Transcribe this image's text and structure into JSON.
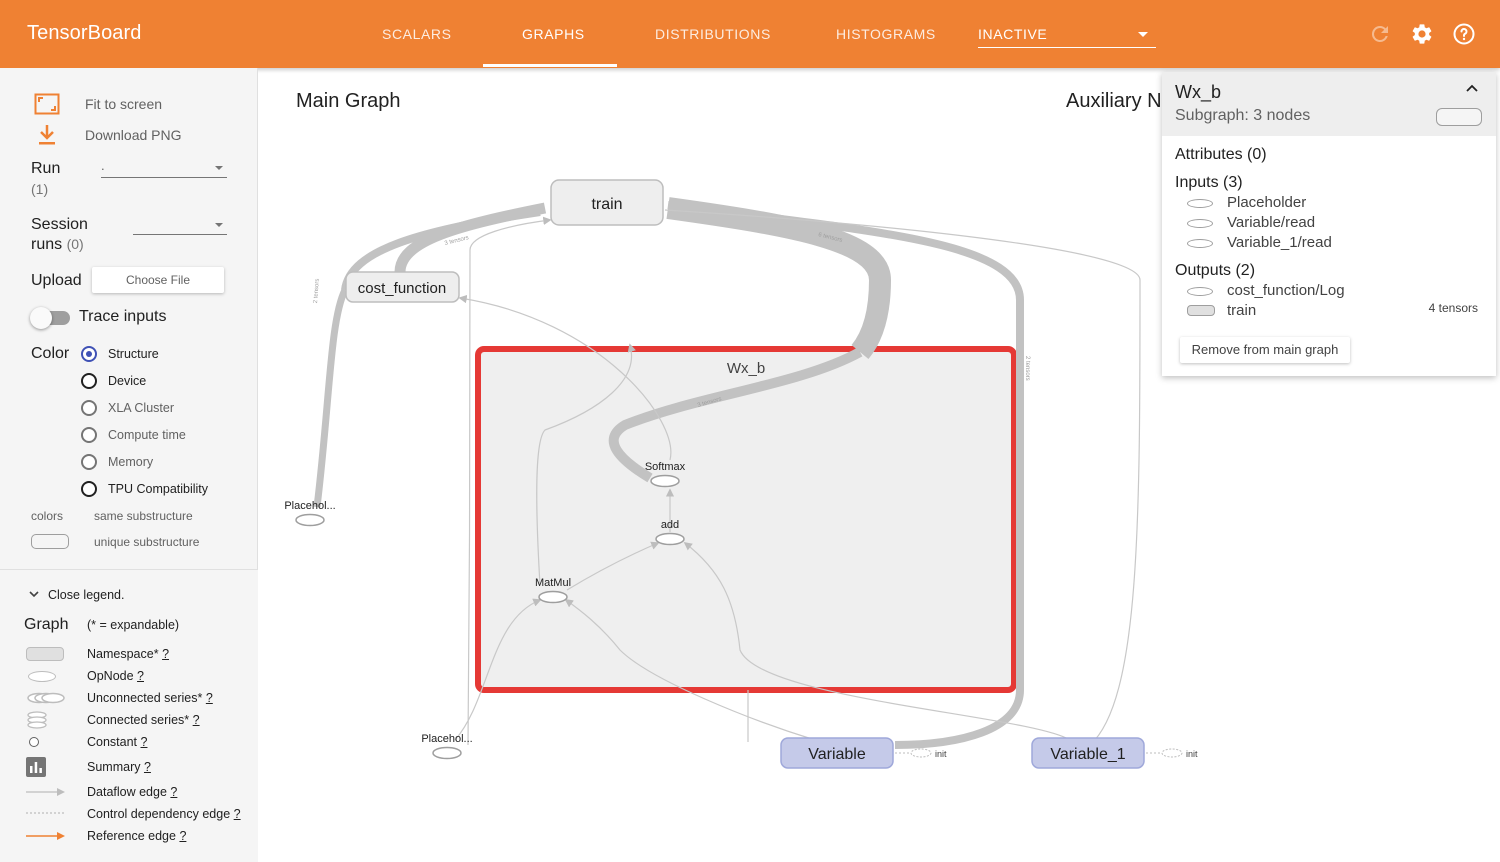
{
  "app": {
    "title": "TensorBoard"
  },
  "tabs": [
    {
      "label": "SCALARS"
    },
    {
      "label": "GRAPHS"
    },
    {
      "label": "DISTRIBUTIONS"
    },
    {
      "label": "HISTOGRAMS"
    }
  ],
  "inactive_select": {
    "label": "INACTIVE"
  },
  "top_icons": [
    "refresh-icon",
    "settings-icon",
    "help-icon"
  ],
  "sidebar": {
    "fit_to_screen": "Fit to screen",
    "download_png": "Download PNG",
    "run_label": "Run",
    "run_count": "(1)",
    "run_value": ".",
    "session_label": "Session",
    "session_label2": "runs",
    "session_count": "(0)",
    "upload_label": "Upload",
    "choose_file": "Choose File",
    "trace_inputs": "Trace inputs",
    "color_label": "Color",
    "color_options": [
      {
        "label": "Structure",
        "selected": true
      },
      {
        "label": "Device",
        "selected": false
      },
      {
        "label": "XLA Cluster",
        "selected": false
      },
      {
        "label": "Compute time",
        "selected": false
      },
      {
        "label": "Memory",
        "selected": false
      },
      {
        "label": "TPU Compatibility",
        "selected": false
      }
    ],
    "colors_label": "colors",
    "same_substructure": "same substructure",
    "unique_substructure": "unique substructure"
  },
  "legend": {
    "close_label": "Close legend.",
    "graph_label": "Graph",
    "expandable_note": "(* = expandable)",
    "items": [
      {
        "label": "Namespace*",
        "q": "?"
      },
      {
        "label": "OpNode",
        "q": "?"
      },
      {
        "label": "Unconnected series*",
        "q": "?"
      },
      {
        "label": "Connected series*",
        "q": "?"
      },
      {
        "label": "Constant",
        "q": "?"
      },
      {
        "label": "Summary",
        "q": "?"
      },
      {
        "label": "Dataflow edge",
        "q": "?"
      },
      {
        "label": "Control dependency edge",
        "q": "?"
      },
      {
        "label": "Reference edge",
        "q": "?"
      }
    ]
  },
  "graph": {
    "main_title": "Main Graph",
    "aux_title": "Auxiliary N",
    "nodes": {
      "train": "train",
      "cost_function": "cost_function",
      "wx_b": "Wx_b",
      "softmax": "Softmax",
      "add": "add",
      "matmul": "MatMul",
      "placeholder_1": "Placehol...",
      "placeholder_2": "Placehol...",
      "variable": "Variable",
      "variable_1": "Variable_1",
      "init_1": "init",
      "init_2": "init"
    },
    "edge_labels": {
      "e1": "3 tensors",
      "e2": "6 tensors",
      "e3": "3 tensors",
      "e4": "2 tensors",
      "e5": "2 tensors"
    }
  },
  "info_card": {
    "name": "Wx_b",
    "subtitle": "Subgraph: 3 nodes",
    "attributes": "Attributes (0)",
    "inputs_title": "Inputs (3)",
    "inputs": [
      "Placeholder",
      "Variable/read",
      "Variable_1/read"
    ],
    "outputs_title": "Outputs (2)",
    "outputs": [
      "cost_function/Log",
      "train"
    ],
    "outputs_meta": "4 tensors",
    "remove_button": "Remove from main graph"
  },
  "colors": {
    "header": "#ef8133",
    "highlight": "#e53935",
    "accent_radio": "#3f51b5",
    "variable_node": "#c5cae9"
  }
}
